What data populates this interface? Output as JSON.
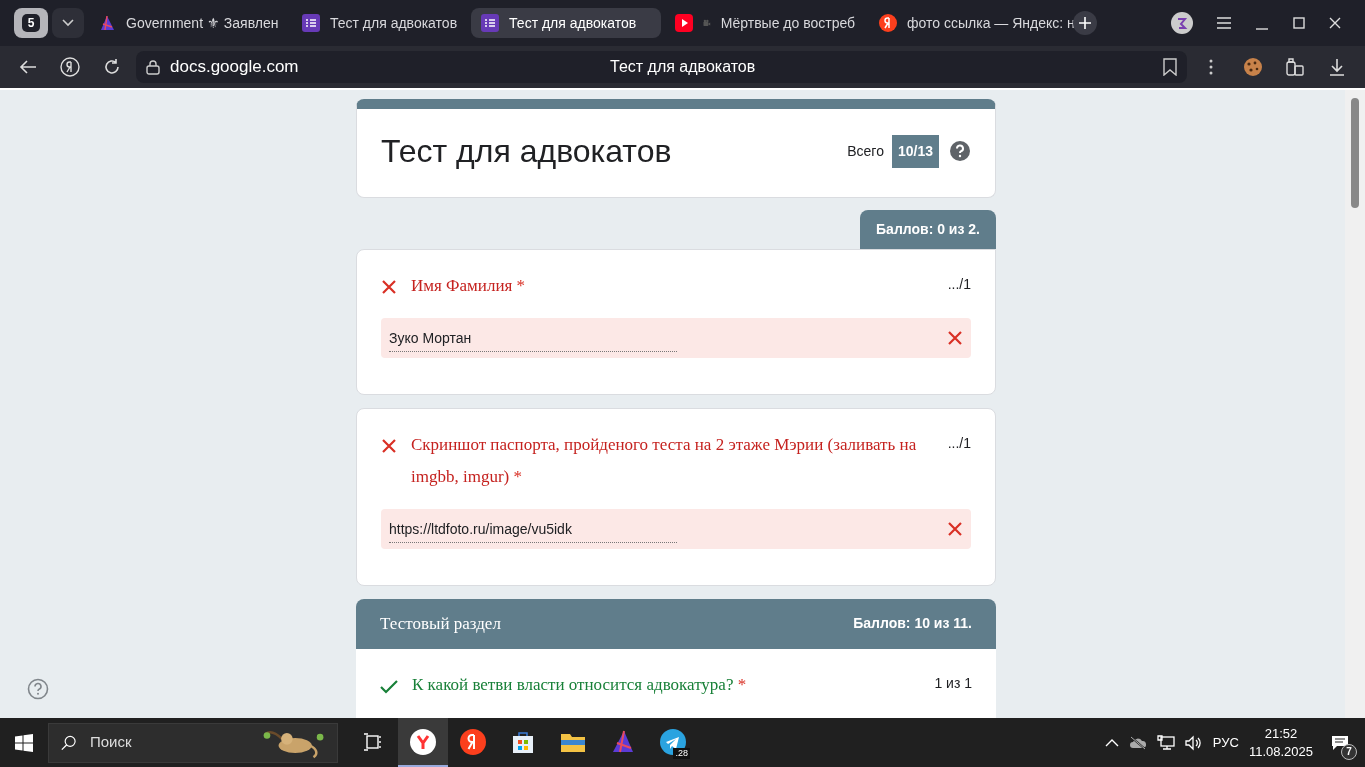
{
  "browser": {
    "tab_count": "5",
    "tabs": [
      {
        "kind": "game",
        "title": "Government ⚜ Заявлен",
        "selected": false
      },
      {
        "kind": "forms",
        "title": "Тест для адвокатов",
        "selected": false
      },
      {
        "kind": "forms",
        "title": "Тест для адвокатов",
        "selected": true
      },
      {
        "kind": "video",
        "title": "Мёртвые до востреб",
        "selected": false
      },
      {
        "kind": "yandex",
        "title": "фото ссылка — Яндекс: н",
        "selected": false
      }
    ],
    "address": "docs.google.com",
    "page_title": "Тест для адвокатов"
  },
  "form": {
    "title": "Тест для адвокатов",
    "total_label": "Всего",
    "total": "10/13",
    "score_tab": "Баллов: 0 из 2.",
    "questions": [
      {
        "correct": false,
        "title": "Имя Фамилия",
        "required": "*",
        "points": ".../1",
        "answer": "Зуко Мортан"
      },
      {
        "correct": false,
        "title": "Скриншот  паспорта, пройденого теста на 2 этаже Мэрии (заливать на imgbb, imgur)",
        "required": "*",
        "points": ".../1",
        "answer": "https://ltdfoto.ru/image/vu5idk"
      }
    ],
    "section": {
      "title": "Тестовый раздел",
      "score": "Баллов: 10 из 11.",
      "questions": [
        {
          "correct": true,
          "title": "К какой ветви власти относится адвокатура?",
          "required": "*",
          "points": "1 из 1"
        }
      ]
    }
  },
  "taskbar": {
    "search_placeholder": "Поиск",
    "apps": [
      {
        "kind": "yandex-browser",
        "selected": true
      },
      {
        "kind": "yandex",
        "selected": false
      },
      {
        "kind": "store",
        "selected": false
      },
      {
        "kind": "folder",
        "selected": false
      },
      {
        "kind": "game",
        "selected": false
      },
      {
        "kind": "telegram",
        "selected": false,
        "badge": ".28"
      }
    ],
    "language": "РУС",
    "time": "21:52",
    "date": "11.08.2025",
    "notifications": "7"
  }
}
